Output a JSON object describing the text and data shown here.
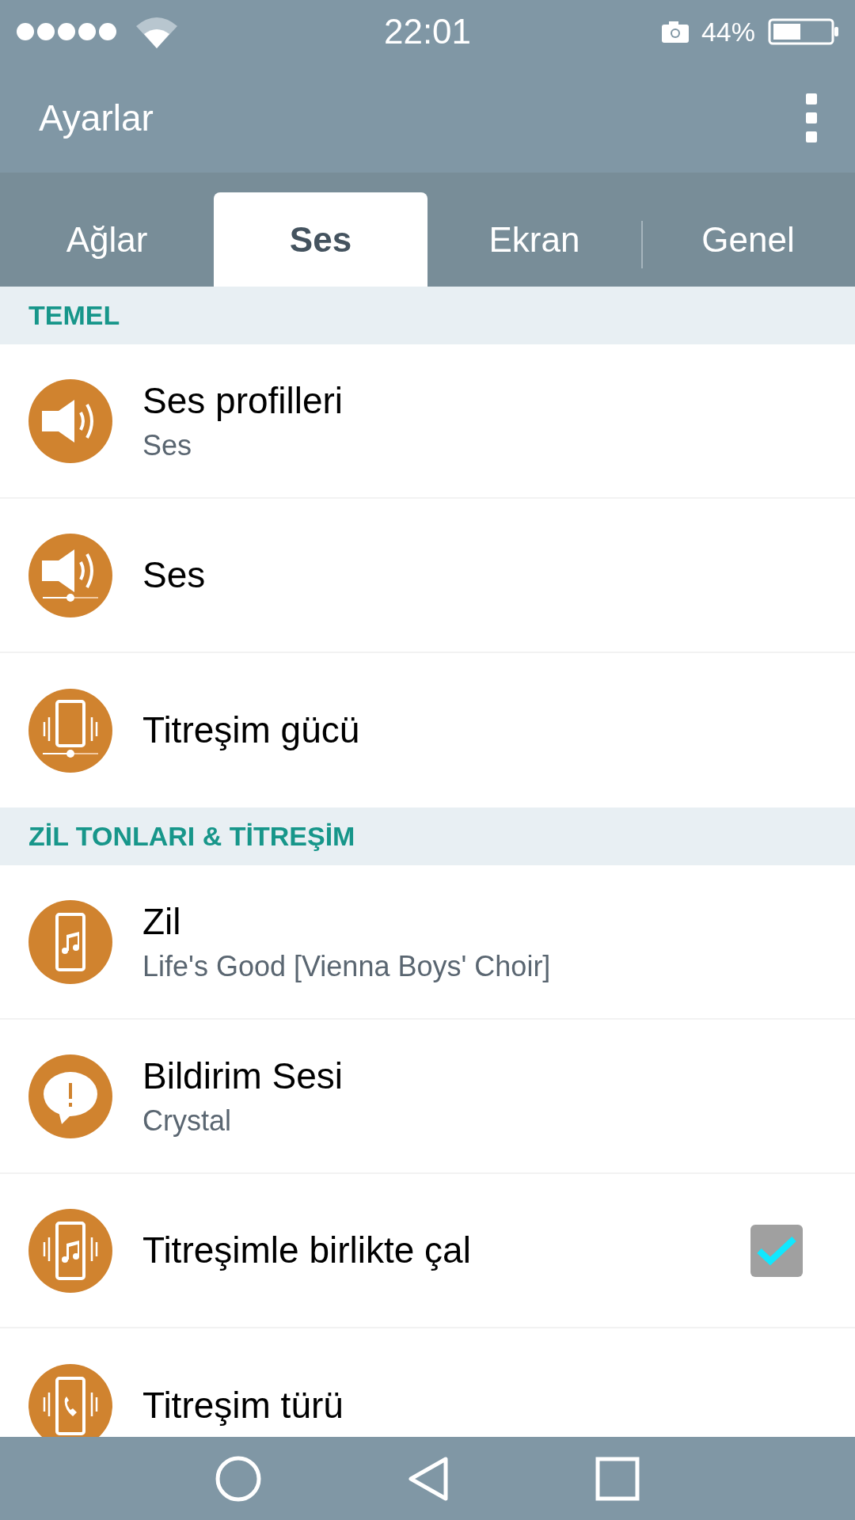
{
  "status_bar": {
    "time": "22:01",
    "battery": "44%"
  },
  "app_bar": {
    "title": "Ayarlar"
  },
  "tabs": [
    {
      "label": "Ağlar",
      "selected": false
    },
    {
      "label": "Ses",
      "selected": true
    },
    {
      "label": "Ekran",
      "selected": false
    },
    {
      "label": "Genel",
      "selected": false
    }
  ],
  "sections": [
    {
      "header": "TEMEL",
      "items": [
        {
          "kind": "plain",
          "title": "Ses profilleri",
          "subtitle": "Ses"
        },
        {
          "kind": "plain",
          "title": "Ses"
        },
        {
          "kind": "plain",
          "title": "Titreşim gücü"
        }
      ]
    },
    {
      "header": "ZİL TONLARI & TİTREŞİM",
      "items": [
        {
          "kind": "plain",
          "title": "Zil",
          "subtitle": "Life's Good [Vienna Boys' Choir]"
        },
        {
          "kind": "plain",
          "title": "Bildirim Sesi",
          "subtitle": "Crystal"
        },
        {
          "kind": "checkbox",
          "title": "Titreşimle birlikte çal",
          "checked": true
        },
        {
          "kind": "plain",
          "title": "Titreşim türü"
        }
      ]
    }
  ]
}
